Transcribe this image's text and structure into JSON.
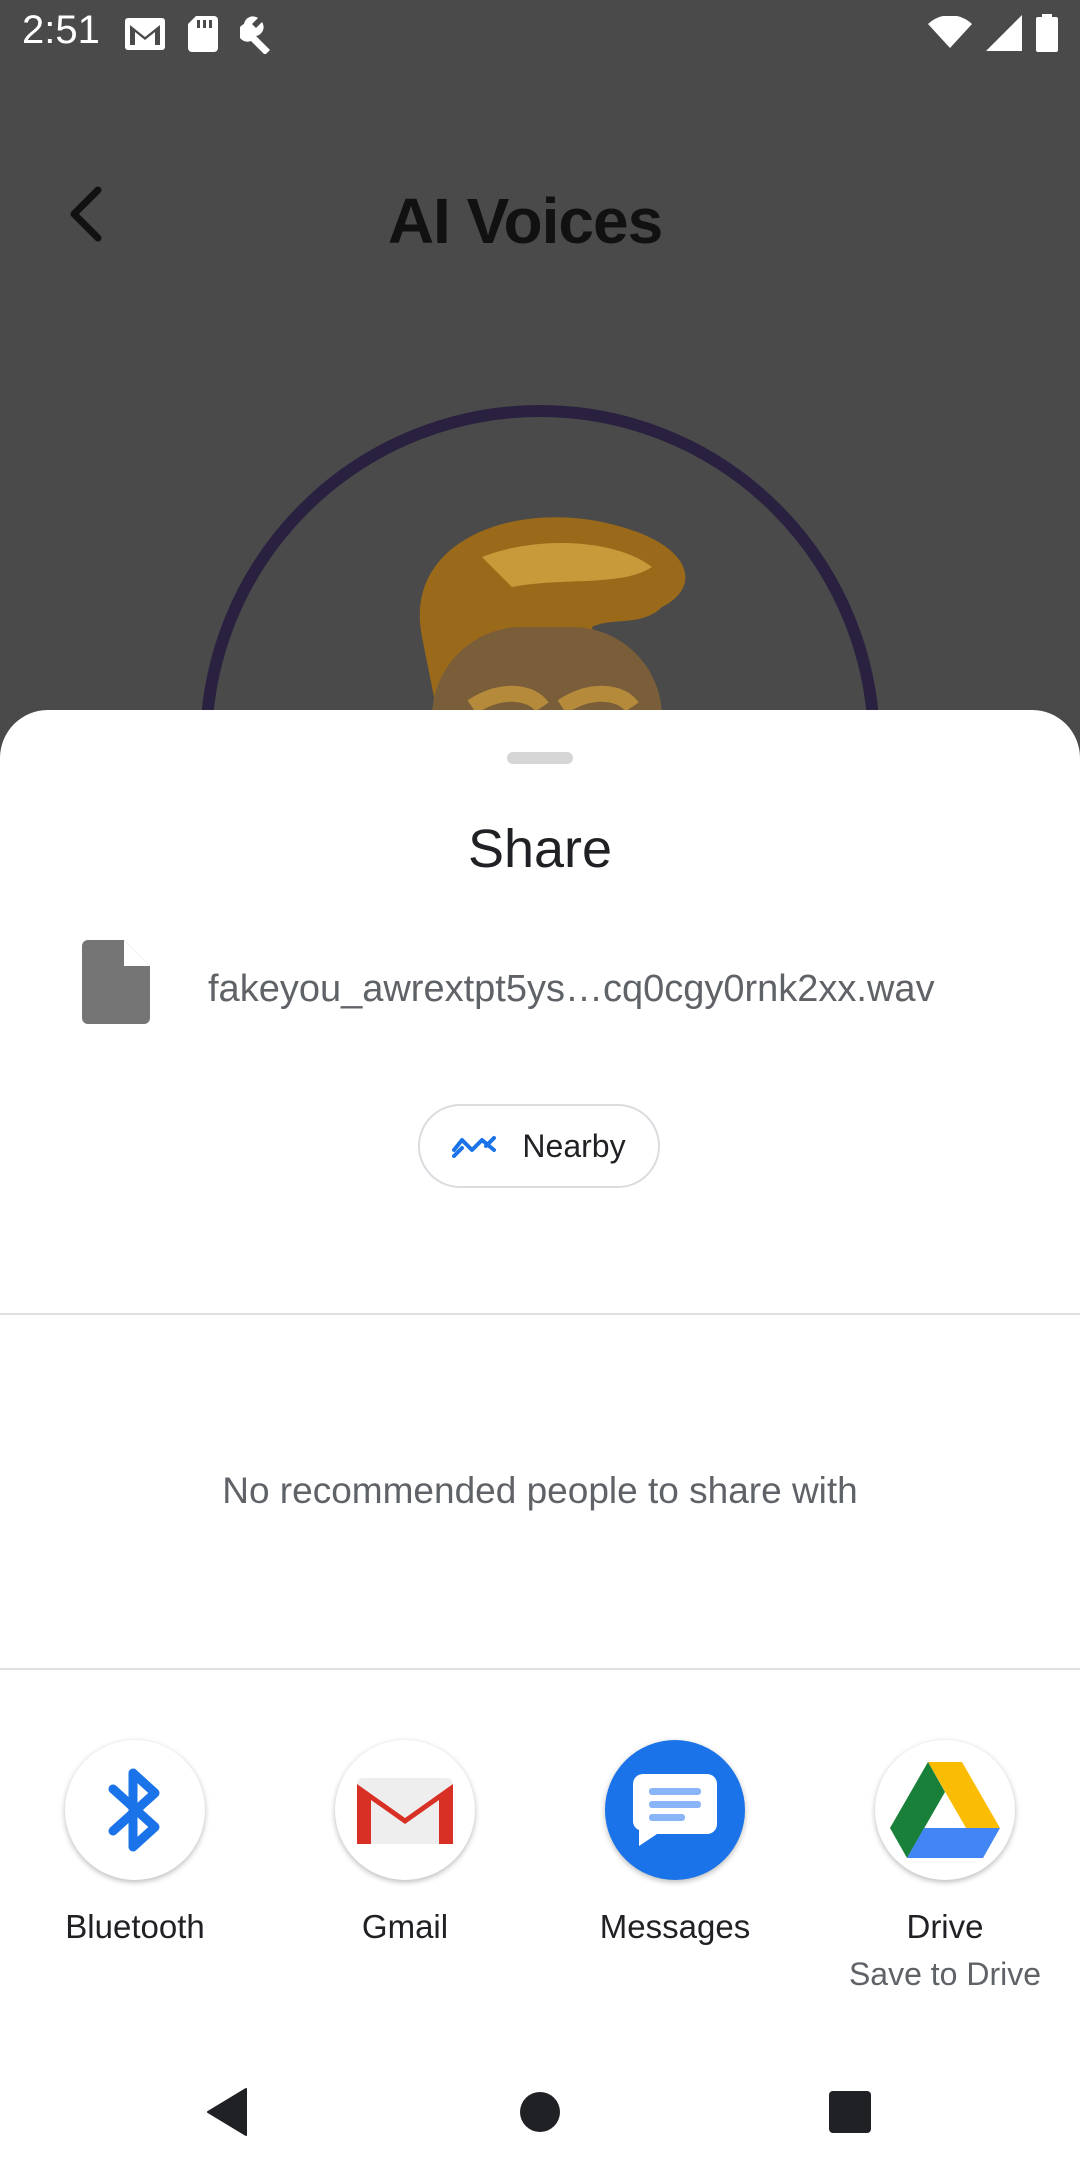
{
  "status_bar": {
    "time": "2:51",
    "left_icons": [
      "gmail-icon",
      "sd-card-icon",
      "wrench-icon"
    ],
    "right_icons": [
      "wifi-icon",
      "signal-icon",
      "battery-icon"
    ]
  },
  "app": {
    "title": "AI Voices"
  },
  "share_sheet": {
    "title": "Share",
    "file_name": "fakeyou_awrextpt5ys…cq0cgy0rnk2xx.wav",
    "nearby_label": "Nearby",
    "no_people_text": "No recommended people to share with",
    "targets": [
      {
        "label": "Bluetooth",
        "sublabel": "",
        "icon": "bluetooth-icon"
      },
      {
        "label": "Gmail",
        "sublabel": "",
        "icon": "gmail-app-icon"
      },
      {
        "label": "Messages",
        "sublabel": "",
        "icon": "messages-icon"
      },
      {
        "label": "Drive",
        "sublabel": "Save to Drive",
        "icon": "drive-icon"
      }
    ]
  },
  "colors": {
    "accent_blue": "#1a73e8",
    "scrim": "#4a4a4a",
    "avatar_ring": "#2a2140"
  }
}
